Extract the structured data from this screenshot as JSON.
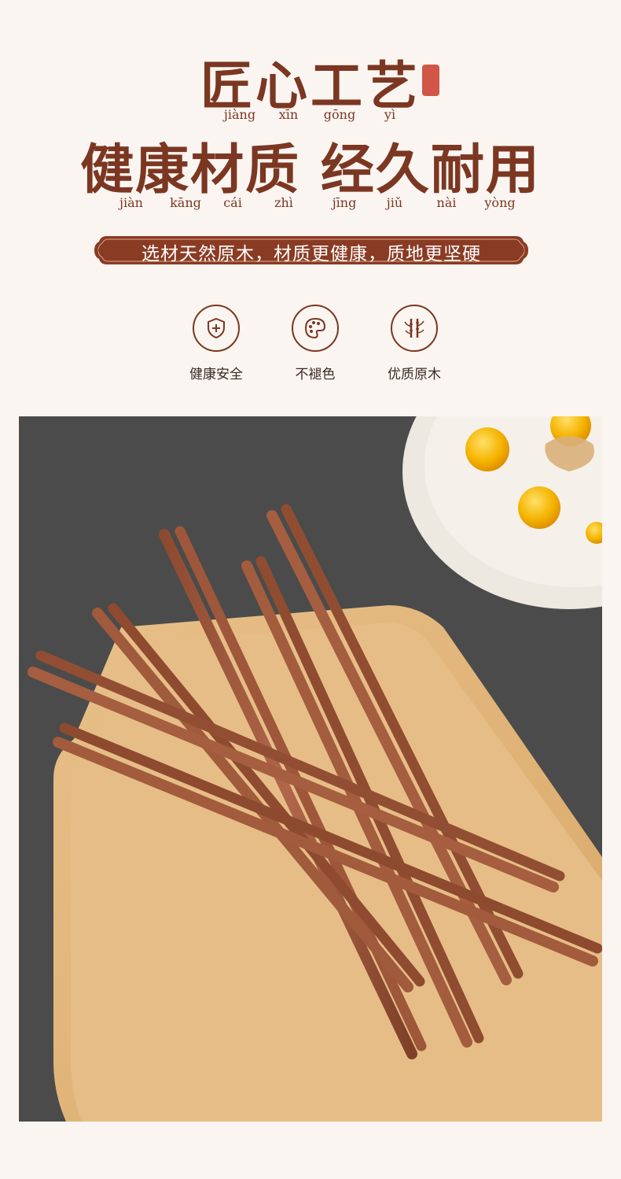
{
  "heading": {
    "title": "匠心工艺",
    "title_pinyin": [
      "jiàng",
      "xīn",
      "gōng",
      "yì"
    ],
    "subtitle": "健康材质 经久耐用",
    "subtitle_pinyin": [
      "jiàn",
      "kāng",
      "cái",
      "zhì",
      "jīng",
      "jiǔ",
      "nài",
      "yòng"
    ]
  },
  "banner": {
    "text": "选材天然原木，材质更健康，质地更坚硬"
  },
  "features": [
    {
      "icon": "shield-plus-icon",
      "label": "健康安全"
    },
    {
      "icon": "palette-icon",
      "label": "不褪色"
    },
    {
      "icon": "bamboo-icon",
      "label": "优质原木"
    }
  ],
  "colors": {
    "accent": "#7b3722",
    "banner": "#8a3b23",
    "background": "#faf5f1",
    "seal": "#c83a2a"
  }
}
